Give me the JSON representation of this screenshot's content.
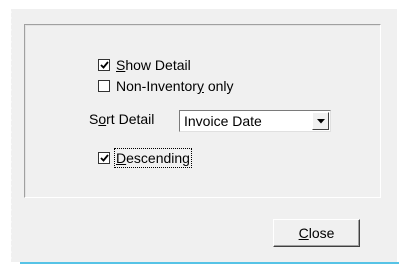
{
  "options": {
    "show_detail": {
      "label_pre": "",
      "mnemonic": "S",
      "label_post": "how Detail",
      "checked": true
    },
    "non_inventory_only": {
      "label_pre": "Non-Inventor",
      "mnemonic": "y",
      "label_post": " only",
      "checked": false
    },
    "sort_detail": {
      "label_pre": "S",
      "mnemonic": "o",
      "label_post": "rt Detail",
      "selected": "Invoice Date"
    },
    "descending": {
      "label_pre": "",
      "mnemonic": "D",
      "label_post": "escending",
      "checked": true
    }
  },
  "buttons": {
    "close": {
      "mnemonic": "C",
      "label_post": "lose"
    }
  },
  "colors": {
    "dialog_bg": "#f0f0f0",
    "accent_line": "#56c3e6"
  },
  "icons": {
    "checkmark": "checkmark-icon",
    "dropdown": "chevron-down-icon"
  }
}
